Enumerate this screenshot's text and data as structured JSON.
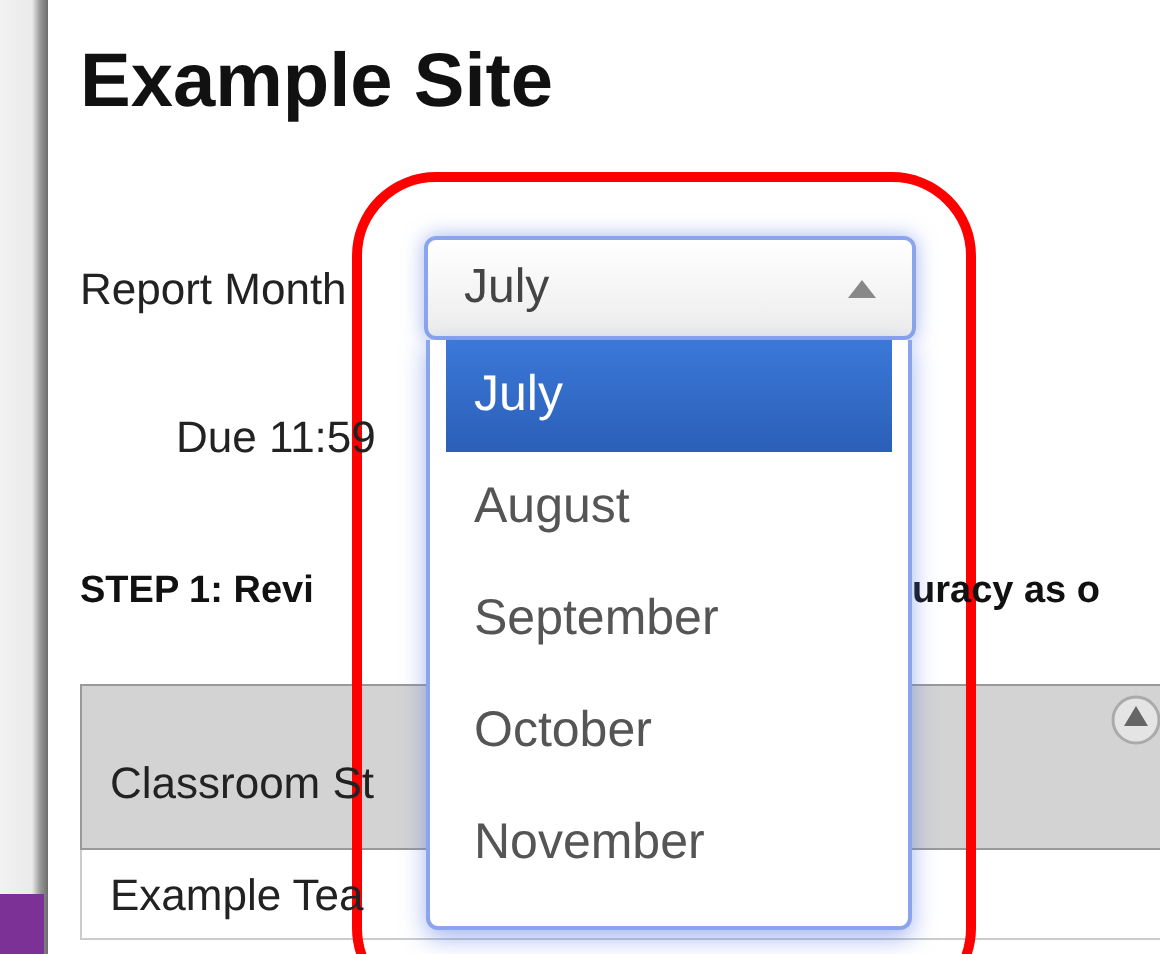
{
  "page_title": "Example Site",
  "report_month": {
    "label": "Report Month",
    "value": "July",
    "expanded": true,
    "options": [
      {
        "label": "July",
        "selected": true
      },
      {
        "label": "August",
        "selected": false
      },
      {
        "label": "September",
        "selected": false
      },
      {
        "label": "October",
        "selected": false
      },
      {
        "label": "November",
        "selected": false
      }
    ]
  },
  "due_text": "Due 11:59",
  "step_text_left": "STEP 1: Revi",
  "step_text_right": "uracy as o",
  "table": {
    "columns": [
      {
        "label": "Classroom St",
        "sortable": true
      }
    ],
    "rows": [
      [
        "Example Tea"
      ]
    ]
  },
  "annotation": {
    "kind": "ring"
  }
}
